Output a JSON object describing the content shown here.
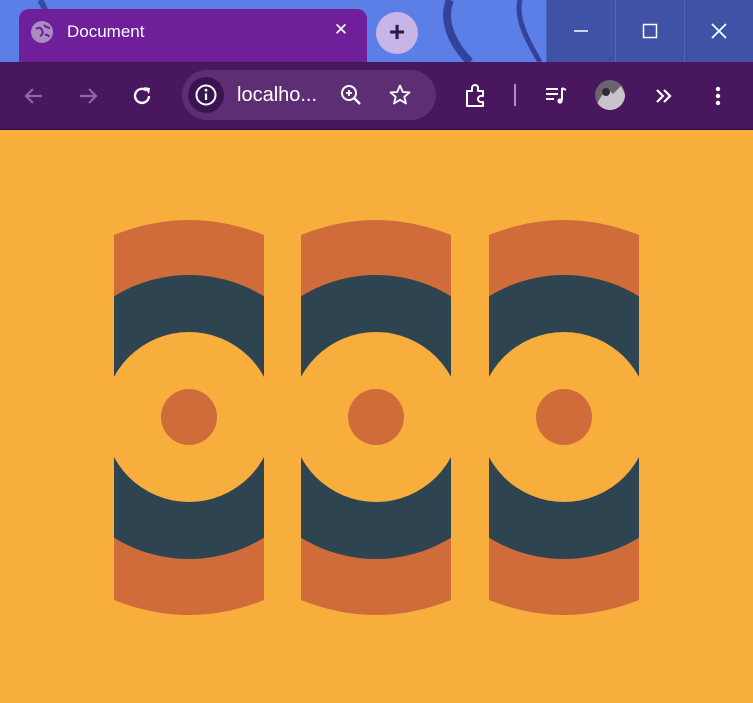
{
  "browser": {
    "tab": {
      "title": "Document",
      "close_glyph": "✕",
      "favicon": "globe-icon"
    },
    "new_tab_glyph": "+",
    "window_controls": [
      "minimize-icon",
      "maximize-icon",
      "close-icon"
    ],
    "toolbar": {
      "url": "localho...",
      "icons": [
        "back-arrow-icon",
        "forward-arrow-icon",
        "reload-icon",
        "site-info-icon",
        "zoom-icon",
        "bookmark-star-icon",
        "extensions-icon",
        "media-control-icon",
        "profile-avatar",
        "more-tools-icon",
        "menu-icon"
      ]
    }
  },
  "page": {
    "background": "#f7ae3d",
    "pattern_colors": {
      "outer_ring": "#d06c3a",
      "middle_ring": "#2f4451",
      "inner_ring": "#f7ae3d",
      "center_dot": "#d06c3a"
    },
    "tile_count": 3
  },
  "theme": {
    "titlebar": "#5b7fe6",
    "tab": "#6e1f99",
    "toolbar": "#48175e",
    "window_buttons": "#3f52a6"
  }
}
